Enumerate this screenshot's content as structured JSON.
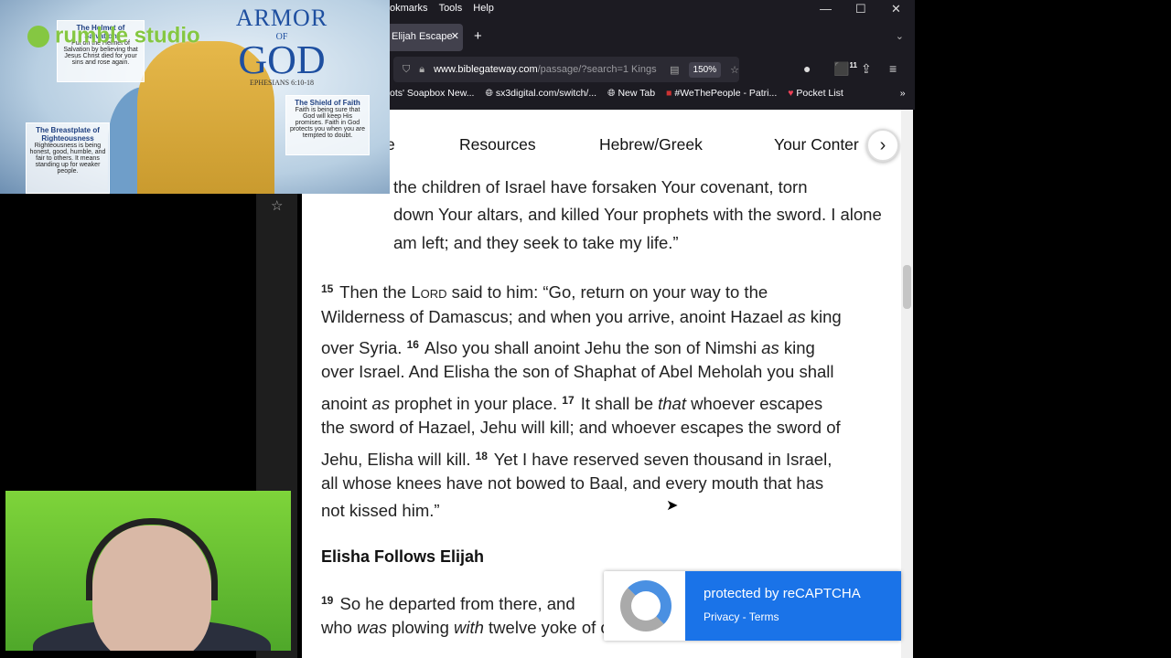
{
  "browser": {
    "menu": [
      "okmarks",
      "Tools",
      "Help"
    ],
    "tab_title": "Elijah Escape",
    "url_domain": "www.biblegateway.com",
    "url_path": "/passage/?search=1 Kings",
    "zoom": "150%",
    "extension_badge": "11",
    "bookmarks": [
      "ots' Soapbox New...",
      "sx3digital.com/switch/...",
      "New Tab",
      "#WeThePeople - Patri...",
      "Pocket List"
    ]
  },
  "page": {
    "nav": [
      "e",
      "Resources",
      "Hebrew/Greek",
      "Your Conter"
    ],
    "lines1": [
      [
        {
          "t": "the children of Israel have forsaken Your covenant, torn"
        }
      ],
      [
        {
          "t": "down Your altars, and killed Your prophets with the sword. I alone"
        }
      ],
      [
        {
          "t": "am left; and they seek to take my life.”"
        }
      ]
    ],
    "lines2": [
      [
        {
          "t": "15",
          "f": "s"
        },
        {
          "t": " Then the L"
        },
        {
          "t": "ord",
          "f": "sc"
        },
        {
          "t": " said to him: “Go, return on your way to the"
        }
      ],
      [
        {
          "t": "Wilderness of Damascus; and when you arrive, anoint Hazael "
        },
        {
          "t": "as",
          "f": "i"
        },
        {
          "t": " king"
        }
      ],
      [
        {
          "t": "over Syria. "
        },
        {
          "t": "16",
          "f": "s"
        },
        {
          "t": " Also you shall anoint Jehu the son of Nimshi "
        },
        {
          "t": "as",
          "f": "i"
        },
        {
          "t": " king"
        }
      ],
      [
        {
          "t": "over Israel. And Elisha the son of Shaphat of Abel Meholah you shall"
        }
      ],
      [
        {
          "t": "anoint "
        },
        {
          "t": "as",
          "f": "i"
        },
        {
          "t": " prophet in your place. "
        },
        {
          "t": "17",
          "f": "s"
        },
        {
          "t": " It shall be "
        },
        {
          "t": "that",
          "f": "i"
        },
        {
          "t": " whoever escapes"
        }
      ],
      [
        {
          "t": "the sword of Hazael, Jehu will kill; and whoever escapes the sword of"
        }
      ],
      [
        {
          "t": "Jehu, Elisha will kill. "
        },
        {
          "t": "18",
          "f": "s"
        },
        {
          "t": " Yet I have reserved seven thousand in Israel,"
        }
      ],
      [
        {
          "t": "all whose knees have not bowed to Baal, and every mouth that has"
        }
      ],
      [
        {
          "t": "not kissed him.”"
        }
      ]
    ],
    "heading": "Elisha Follows Elijah",
    "lines3": [
      [
        {
          "t": "19",
          "f": "s"
        },
        {
          "t": " So he departed from there, and"
        }
      ],
      [
        {
          "t": "who "
        },
        {
          "t": "was",
          "f": "i"
        },
        {
          "t": " plowing "
        },
        {
          "t": "with",
          "f": "i"
        },
        {
          "t": " twelve yoke of oxen before him, and he was"
        }
      ]
    ]
  },
  "recaptcha": {
    "title": "protected by reCAPTCHA",
    "links": "Privacy - Terms"
  },
  "overlay": {
    "brand": "rumble studio",
    "art": {
      "title1": "ARMOR",
      "title2": "OF",
      "title3": "GOD",
      "ref": "EPHESIANS 6:10-18",
      "helmet_title": "The Helmet of Salvation",
      "helmet_text": "Put on the Helmet of Salvation by believing that Jesus Christ died for your sins and rose again.",
      "shield_title": "The Shield of Faith",
      "shield_text": "Faith is being sure that God will keep His promises. Faith in God protects you when you are tempted to doubt.",
      "breast_title": "The Breastplate of Righteousness",
      "breast_text": "Righteousness is being honest, good, humble, and fair to others. It means standing up for weaker people."
    }
  },
  "colors": {
    "recaptcha_blue": "#1a73e8",
    "rumble_green": "#85c742",
    "browser_dark": "#1c1b22"
  }
}
